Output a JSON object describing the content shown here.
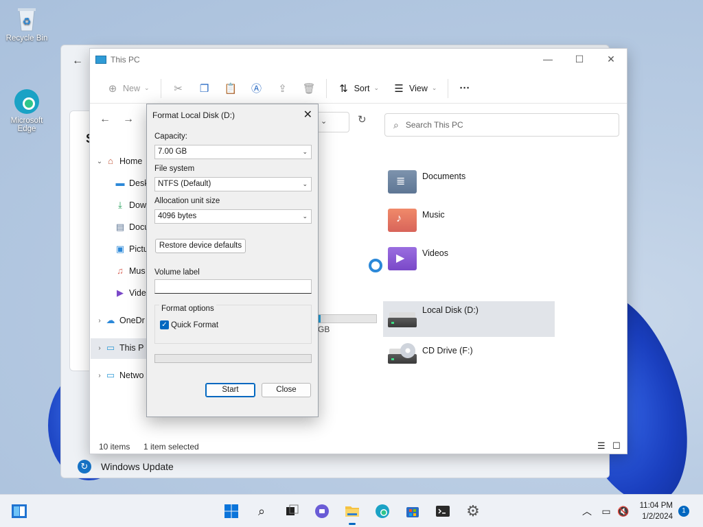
{
  "desktop": {
    "icons": [
      {
        "label": "Recycle Bin",
        "icon": "recycle-bin-icon"
      },
      {
        "label": "Microsoft\nEdge",
        "icon": "edge-icon"
      }
    ]
  },
  "settings_window": {
    "card_letter": "S",
    "windows_update_label": "Windows Update"
  },
  "explorer": {
    "title": "This PC",
    "toolbar": {
      "new_label": "New",
      "sort_label": "Sort",
      "view_label": "View",
      "more_label": "···"
    },
    "search_placeholder": "Search This PC",
    "sidebar": [
      {
        "label": "Home",
        "caret": "⌄",
        "icon": "home-icon"
      },
      {
        "label": "Desk",
        "icon": "desktop-icon"
      },
      {
        "label": "Dow",
        "icon": "download-icon"
      },
      {
        "label": "Docu",
        "icon": "document-icon"
      },
      {
        "label": "Pictu",
        "icon": "pictures-icon"
      },
      {
        "label": "Mus",
        "icon": "music-icon"
      },
      {
        "label": "Vide",
        "icon": "video-icon"
      },
      {
        "label": "OneDr",
        "caret": "›",
        "icon": "onedrive-icon"
      },
      {
        "label": "This P",
        "caret": "›",
        "icon": "this-pc-icon"
      },
      {
        "label": "Netwo",
        "caret": "›",
        "icon": "network-icon"
      }
    ],
    "items": [
      {
        "label": "Documents",
        "icon": "documents-folder-icon"
      },
      {
        "label": "Music",
        "icon": "music-folder-icon"
      },
      {
        "label": "Videos",
        "icon": "videos-folder-icon"
      },
      {
        "label": "Local Disk (D:)",
        "icon": "local-disk-icon"
      },
      {
        "label": "CD Drive (F:)",
        "icon": "cd-drive-icon"
      }
    ],
    "partial_drive_text": "GB",
    "status": {
      "count": "10 items",
      "selected": "1 item selected"
    }
  },
  "format_dialog": {
    "title": "Format Local Disk (D:)",
    "capacity_label": "Capacity:",
    "capacity_value": "7.00 GB",
    "filesystem_label": "File system",
    "filesystem_value": "NTFS (Default)",
    "allocation_label": "Allocation unit size",
    "allocation_value": "4096 bytes",
    "restore_label": "Restore device defaults",
    "volume_label": "Volume label",
    "volume_value": "",
    "format_options_label": "Format options",
    "quick_format_label": "Quick Format",
    "quick_format_checked": true,
    "start_label": "Start",
    "close_label": "Close"
  },
  "taskbar": {
    "time": "11:04 PM",
    "date": "1/2/2024",
    "notification_count": "1"
  },
  "colors": {
    "accent": "#0067c0",
    "selection": "#e1e4e9"
  }
}
